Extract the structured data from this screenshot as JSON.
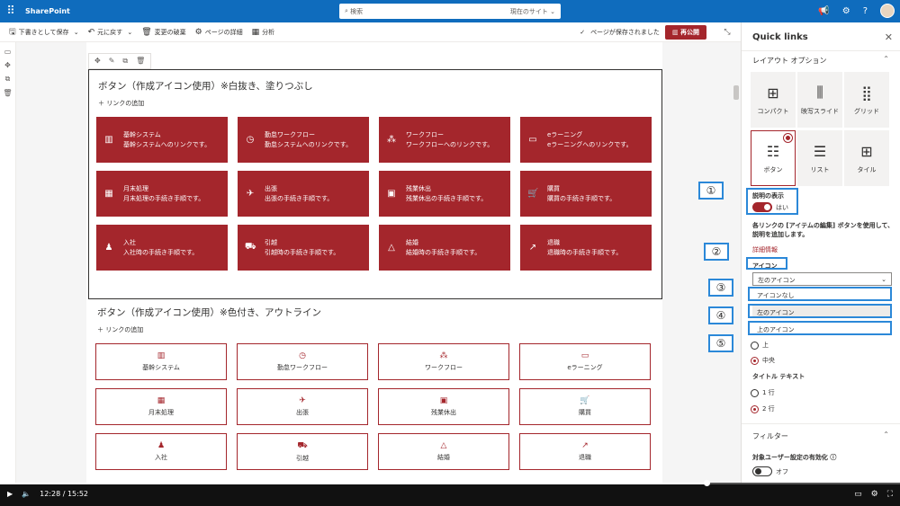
{
  "topbar": {
    "app_name": "SharePoint",
    "search_placeholder": "検索",
    "search_scope": "現在のサイト"
  },
  "cmdbar": {
    "save_draft": "下書きとして保存",
    "undo": "元に戻す",
    "discard": "変更の破棄",
    "page_details": "ページの詳細",
    "analytics": "分析",
    "saved_status": "ページが保存されました",
    "republish": "再公開"
  },
  "section1": {
    "title": "ボタン（作成アイコン使用）※白抜き、塗りつぶし",
    "add_link": "＋ リンクの追加",
    "items": [
      {
        "name": "基幹システム",
        "desc": "基幹システムへのリンクです。"
      },
      {
        "name": "勤怠ワークフロー",
        "desc": "勤怠システムへのリンクです。"
      },
      {
        "name": "ワークフロー",
        "desc": "ワークフローへのリンクです。"
      },
      {
        "name": "eラーニング",
        "desc": "eラーニングへのリンクです。"
      },
      {
        "name": "月末処理",
        "desc": "月末処理の手続き手順です。"
      },
      {
        "name": "出張",
        "desc": "出張の手続き手順です。"
      },
      {
        "name": "残業休出",
        "desc": "残業休出の手続き手順です。"
      },
      {
        "name": "購買",
        "desc": "購買の手続き手順です。"
      },
      {
        "name": "入社",
        "desc": "入社時の手続き手順です。"
      },
      {
        "name": "引越",
        "desc": "引越時の手続き手順です。"
      },
      {
        "name": "結婚",
        "desc": "結婚時の手続き手順です。"
      },
      {
        "name": "退職",
        "desc": "退職時の手続き手順です。"
      }
    ]
  },
  "section2": {
    "title": "ボタン（作成アイコン使用）※色付き、アウトライン",
    "add_link": "＋ リンクの追加",
    "items": [
      "基幹システム",
      "勤怠ワークフロー",
      "ワークフロー",
      "eラーニング",
      "月末処理",
      "出張",
      "残業休出",
      "購買",
      "入社",
      "引越",
      "結婚",
      "退職"
    ]
  },
  "panel": {
    "title": "Quick links",
    "layout_header": "レイアウト オプション",
    "layouts": [
      "コンパクト",
      "映写スライド",
      "グリッド",
      "ボタン",
      "リスト",
      "タイル"
    ],
    "show_desc_label": "説明の表示",
    "show_desc_value": "はい",
    "desc_help": "各リンクの [アイテムの編集] ボタンを使用して、説明を追加します。",
    "details_link": "詳細情報",
    "icon_label": "アイコン",
    "icon_selected": "左のアイコン",
    "icon_options": [
      "アイコンなし",
      "左のアイコン",
      "上のアイコン"
    ],
    "align_options": [
      "上",
      "中央"
    ],
    "title_text_label": "タイトル テキスト",
    "title_text_options": [
      "1 行",
      "2 行"
    ],
    "filter_header": "フィルター",
    "audience_label": "対象ユーザー設定の有効化",
    "audience_value": "オフ"
  },
  "callouts": [
    "①",
    "②",
    "③",
    "④",
    "⑤"
  ],
  "video": {
    "time": "12:28 / 15:52",
    "progress": 0.785
  },
  "colors": {
    "accent": "#a4262c",
    "suite": "#0f6cbd",
    "callout": "#2b88d8"
  }
}
